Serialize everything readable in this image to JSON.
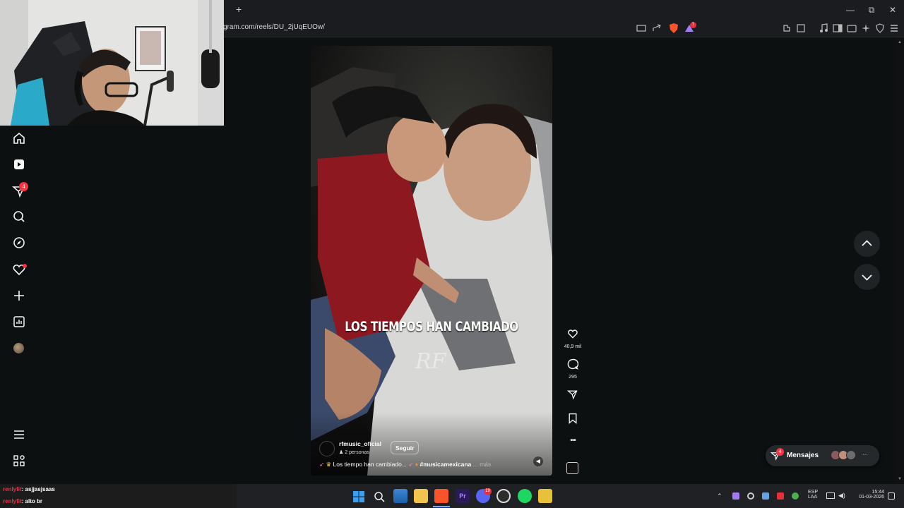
{
  "browser": {
    "new_tab": "+",
    "url": "gram.com/reels/DU_2jUqEUOw/",
    "brave_badge": "1",
    "close_tab": "×",
    "window": {
      "minimize": "—",
      "restore": "⧉",
      "close": "✕"
    }
  },
  "sidebar": {
    "items": [
      {
        "icon": "home-icon"
      },
      {
        "icon": "reels-icon"
      },
      {
        "icon": "messages-icon",
        "badge": "4"
      },
      {
        "icon": "search-icon"
      },
      {
        "icon": "explore-icon"
      },
      {
        "icon": "notifications-icon"
      },
      {
        "icon": "create-icon"
      },
      {
        "icon": "dashboard-icon"
      },
      {
        "icon": "profile-avatar"
      }
    ],
    "more_icon": "menu-icon",
    "also_from_meta_icon": "apps-icon"
  },
  "reel": {
    "caption_overlay": "LOS TIEMPOS HAN CAMBIADO",
    "watermark": "RF",
    "username": "rfmusic_oficial",
    "follow_label": "Seguir",
    "audience": "2 personas",
    "description": "Los tiempo han cambiado...",
    "hashtag": "#musicamexicana",
    "more_label": "... más"
  },
  "actions": {
    "likes": "40,9 mil",
    "comments": "295"
  },
  "messages_button": {
    "label": "Mensajes",
    "badge": "4",
    "ellipsis": "···"
  },
  "chat": [
    {
      "user": "renlyfit",
      "message": ": asjjasjsaas"
    },
    {
      "user": "renlyfit",
      "message": ": alto br"
    }
  ],
  "taskbar": {
    "lang": "ESP",
    "lang2": "LAA",
    "time": "15:44",
    "date": "01-03-2026",
    "discord_badge": "19"
  },
  "colors": {
    "accent_red": "#ff3040",
    "instagram_bg": "#0c1011",
    "chat_name": "#e0324b"
  }
}
